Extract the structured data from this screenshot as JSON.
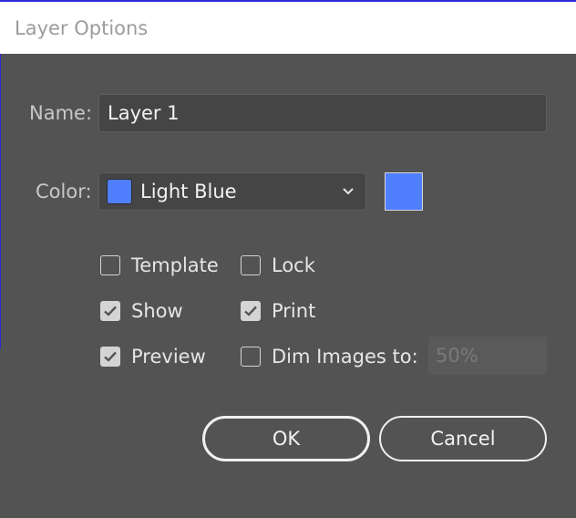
{
  "window": {
    "title": "Layer Options"
  },
  "name_field": {
    "label": "Name:",
    "value": "Layer 1"
  },
  "color_field": {
    "label": "Color:",
    "selected": "Light Blue",
    "swatch_color": "#4f7fff"
  },
  "options": {
    "template": {
      "label": "Template",
      "checked": false
    },
    "lock": {
      "label": "Lock",
      "checked": false
    },
    "show": {
      "label": "Show",
      "checked": true
    },
    "print": {
      "label": "Print",
      "checked": true
    },
    "preview": {
      "label": "Preview",
      "checked": true
    },
    "dim_images": {
      "label": "Dim Images to:",
      "checked": false,
      "value": "50%"
    }
  },
  "buttons": {
    "ok": "OK",
    "cancel": "Cancel"
  },
  "colors": {
    "background": "#535353",
    "accent_blue": "#4f7fff",
    "window_border": "#2b2bd9"
  }
}
